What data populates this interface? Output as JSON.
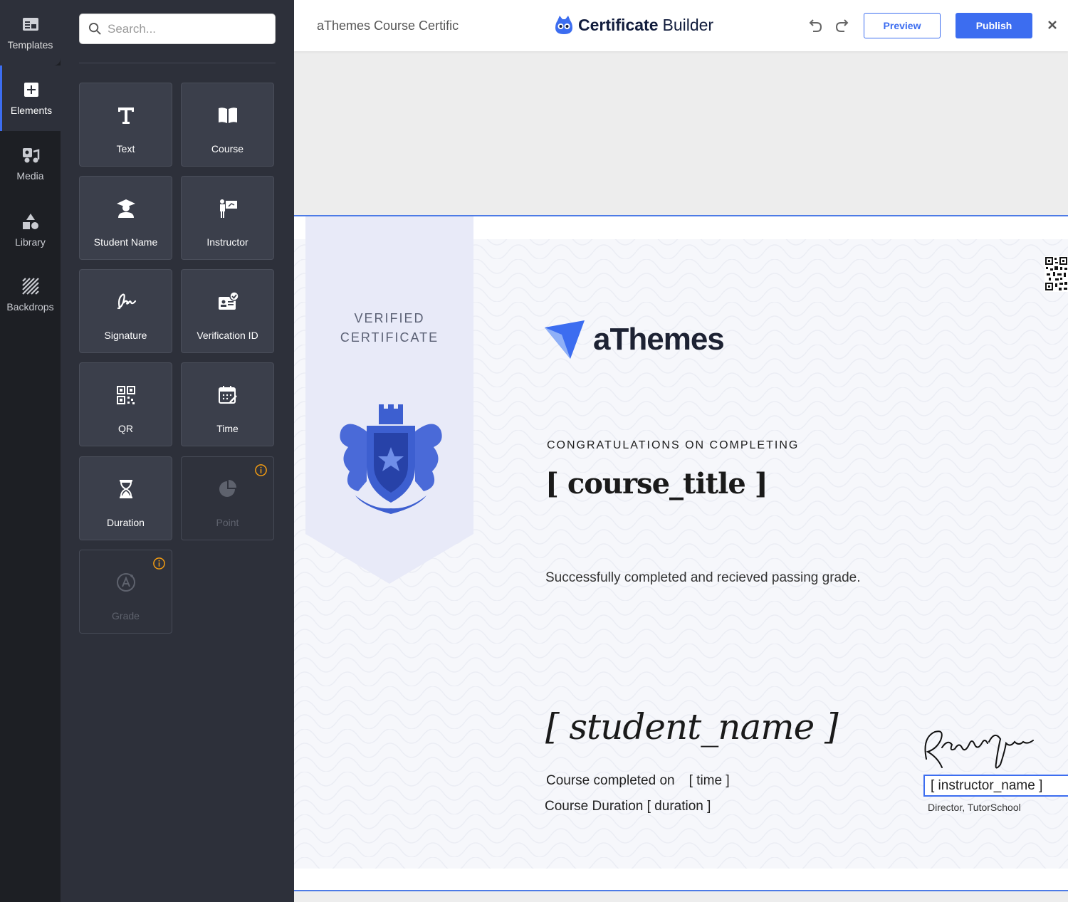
{
  "rail": {
    "templates": "Templates",
    "elements": "Elements",
    "media": "Media",
    "library": "Library",
    "backdrops": "Backdrops"
  },
  "search": {
    "placeholder": "Search..."
  },
  "tiles": {
    "text": "Text",
    "course": "Course",
    "student_name": "Student Name",
    "instructor": "Instructor",
    "signature": "Signature",
    "verification_id": "Verification ID",
    "qr": "QR",
    "time": "Time",
    "duration": "Duration",
    "point": "Point",
    "grade": "Grade"
  },
  "topbar": {
    "doc_title": "aThemes Course Certific",
    "brand_bold": "Certificate",
    "brand_light": "Builder",
    "preview": "Preview",
    "publish": "Publish"
  },
  "certificate": {
    "verified_line1": "VERIFIED",
    "verified_line2": "CERTIFICATE",
    "logo_text": "aThemes",
    "congrats": "CONGRATULATIONS ON COMPLETING",
    "course_title": "[ course_title ]",
    "passing": "Successfully completed and recieved passing grade.",
    "student_name": "[ student_name ]",
    "completed_on_label": "Course completed on",
    "time_placeholder": "[ time ]",
    "duration_label": "Course Duration",
    "duration_placeholder": "[ duration ]",
    "instructor_name": "[ instructor_name ]",
    "instructor_role": "Director, TutorSchool"
  },
  "colors": {
    "accent": "#3c6df0",
    "rail_bg": "#1d1f24",
    "panel_bg": "#2d303a",
    "tile_bg": "#3b3f4b",
    "ribbon": "#e8eaf8",
    "crest": "#3d5fd0",
    "info_orange": "#f39c12"
  }
}
